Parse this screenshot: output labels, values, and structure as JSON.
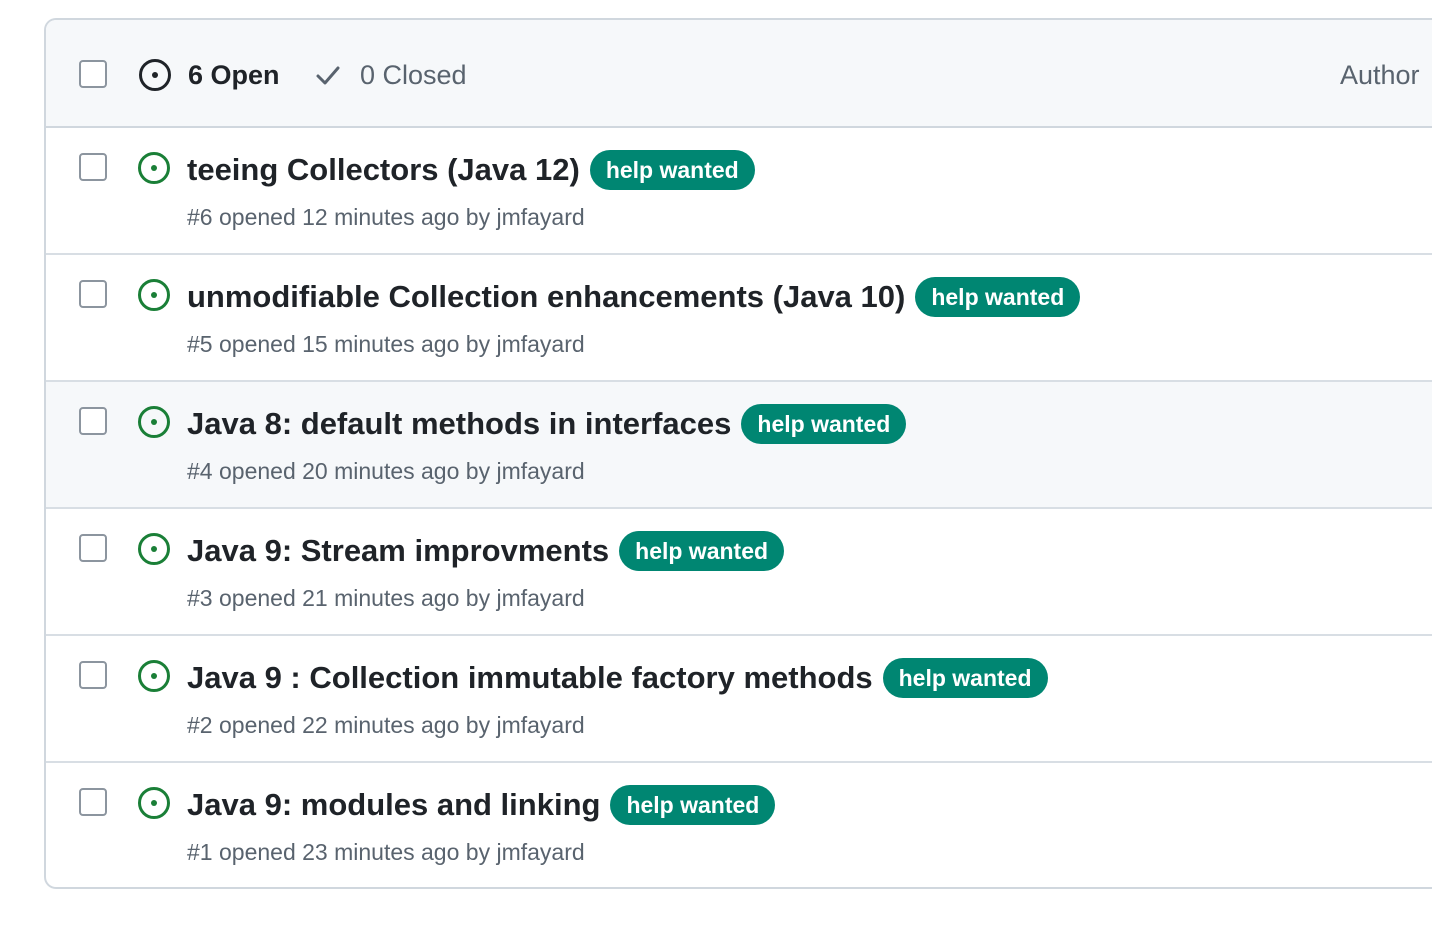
{
  "header": {
    "open_count": "6 Open",
    "closed_count": "0 Closed",
    "author_filter": "Author"
  },
  "colors": {
    "open_green": "#1a7f37",
    "label_bg": "#008672",
    "label_text": "#ffffff",
    "muted_text": "#59636e"
  },
  "issues": [
    {
      "title": "teeing Collectors (Java 12)",
      "label": "help wanted",
      "number": "#6",
      "opened_text": "opened 12 minutes ago by",
      "author": "jmfayard"
    },
    {
      "title": "unmodifiable Collection enhancements (Java 10)",
      "label": "help wanted",
      "number": "#5",
      "opened_text": "opened 15 minutes ago by",
      "author": "jmfayard"
    },
    {
      "title": "Java 8: default methods in interfaces",
      "label": "help wanted",
      "number": "#4",
      "opened_text": "opened 20 minutes ago by",
      "author": "jmfayard"
    },
    {
      "title": "Java 9: Stream improvments",
      "label": "help wanted",
      "number": "#3",
      "opened_text": "opened 21 minutes ago by",
      "author": "jmfayard"
    },
    {
      "title": "Java 9 : Collection immutable factory methods",
      "label": "help wanted",
      "number": "#2",
      "opened_text": "opened 22 minutes ago by",
      "author": "jmfayard"
    },
    {
      "title": "Java 9: modules and linking",
      "label": "help wanted",
      "number": "#1",
      "opened_text": "opened 23 minutes ago by",
      "author": "jmfayard"
    }
  ]
}
